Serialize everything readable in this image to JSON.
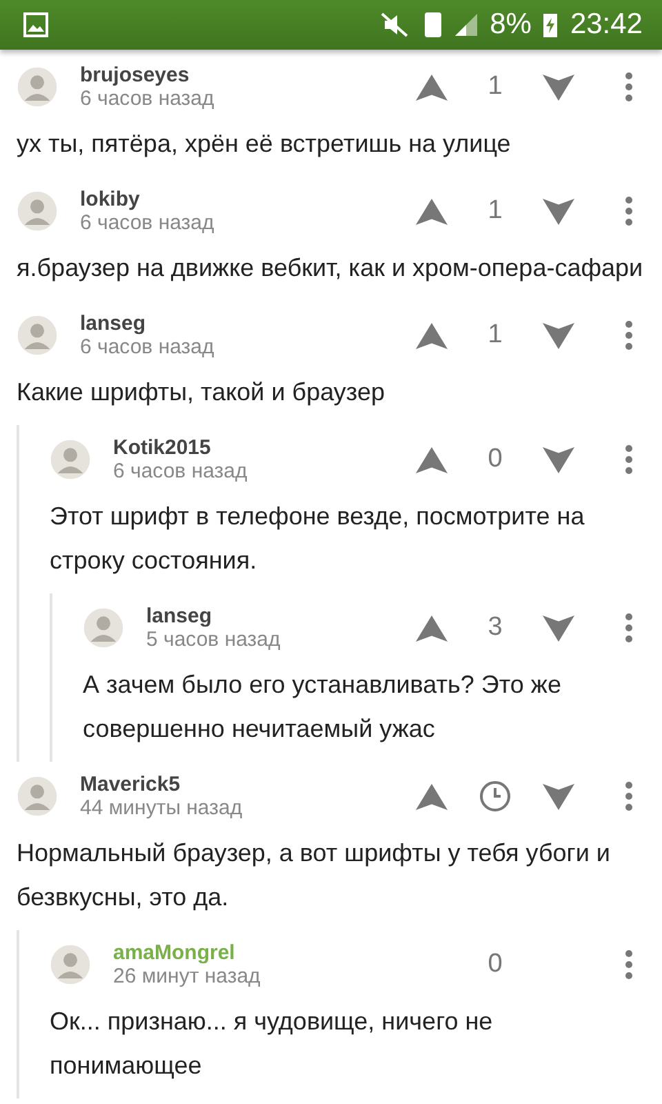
{
  "status_bar": {
    "battery": "8%",
    "time": "23:42"
  },
  "comments": [
    {
      "author": "brujoseyes",
      "time": "6 часов назад",
      "highlighted": false,
      "vote": {
        "kind": "score",
        "score": "1"
      },
      "text": "ух ты, пятёра, хрён её встретишь на улице"
    },
    {
      "author": "lokiby",
      "time": "6 часов назад",
      "highlighted": false,
      "vote": {
        "kind": "score",
        "score": "1"
      },
      "text": "я.браузер на движке вебкит, как и хром-опера-сафари"
    },
    {
      "author": "lanseg",
      "time": "6 часов назад",
      "highlighted": false,
      "vote": {
        "kind": "score",
        "score": "1"
      },
      "text": "Какие шрифты, такой и браузер",
      "children": [
        {
          "author": "Kotik2015",
          "time": "6 часов назад",
          "highlighted": false,
          "vote": {
            "kind": "score",
            "score": "0"
          },
          "text": "Этот шрифт в телефоне везде, посмотрите на строку состояния.",
          "children": [
            {
              "author": "lanseg",
              "time": "5 часов назад",
              "highlighted": false,
              "vote": {
                "kind": "score",
                "score": "3"
              },
              "text": "А зачем было его устанавливать? Это же совершенно нечитаемый ужас"
            }
          ]
        }
      ]
    },
    {
      "author": "Maverick5",
      "time": "44 минуты назад",
      "highlighted": false,
      "vote": {
        "kind": "pending"
      },
      "text": "Нормальный браузер, а вот шрифты у тебя убоги и безвкусны, это да.",
      "children": [
        {
          "author": "amaMongrel",
          "time": "26 минут назад",
          "highlighted": true,
          "vote": {
            "kind": "own",
            "score": "0"
          },
          "text": "Ок... признаю... я чудовище, ничего не понимающее"
        }
      ]
    }
  ]
}
